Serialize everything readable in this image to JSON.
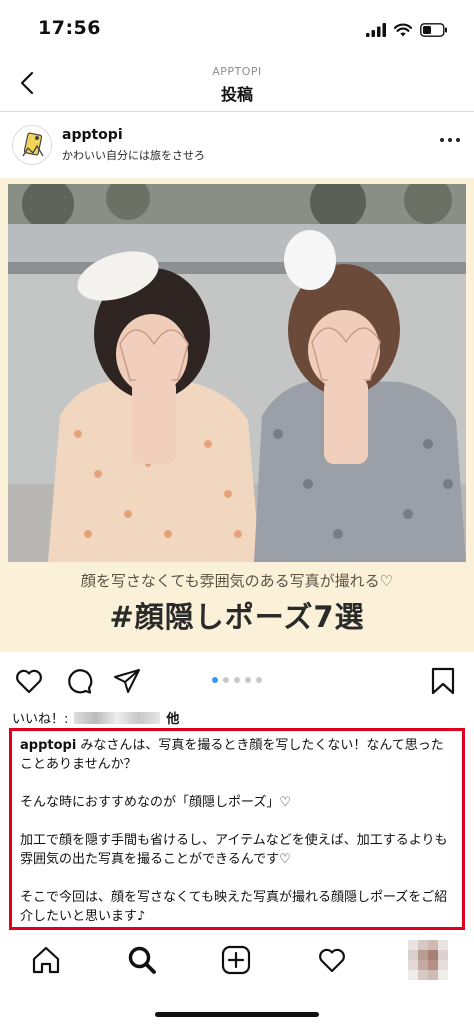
{
  "status": {
    "time": "17:56"
  },
  "nav": {
    "subtitle": "APPTOPI",
    "title": "投稿"
  },
  "post": {
    "username": "apptopi",
    "user_subtitle": "かわいい自分には旅をさせろ",
    "image_caption_small": "顔を写さなくても雰囲気のある写真が撮れる♡",
    "image_caption_large": "#顔隠しポーズ7選",
    "carousel": {
      "count": 5,
      "active": 1
    },
    "likes_prefix": "いいね！:",
    "likes_suffix": "他",
    "caption_user": "apptopi",
    "caption_line1": " みなさんは、写真を撮るとき顔を写したくない！なんて思ったことありませんか？",
    "caption_line2": "そんな時におすすめなのが「顔隠しポーズ」♡",
    "caption_line3": "加工で顔を隠す手間も省けるし、アイテムなどを使えば、加工するよりも雰囲気の出た写真を撮ることができるんです♡",
    "caption_line4": "そこで今回は、顔を写さなくても映えた写真が撮れる顔隠しポーズをご紹介したいと思います♪"
  },
  "icons": {
    "back": "chevron-left-icon",
    "more": "more-horizontal-icon",
    "like": "heart-icon",
    "comment": "comment-icon",
    "share": "send-icon",
    "save": "bookmark-icon",
    "home": "home-icon",
    "search": "search-icon",
    "add": "add-post-icon",
    "activity": "heart-icon"
  },
  "colors": {
    "highlight_border": "#e0001b",
    "carousel_active": "#3897f0",
    "image_bg": "#faf1d8"
  }
}
